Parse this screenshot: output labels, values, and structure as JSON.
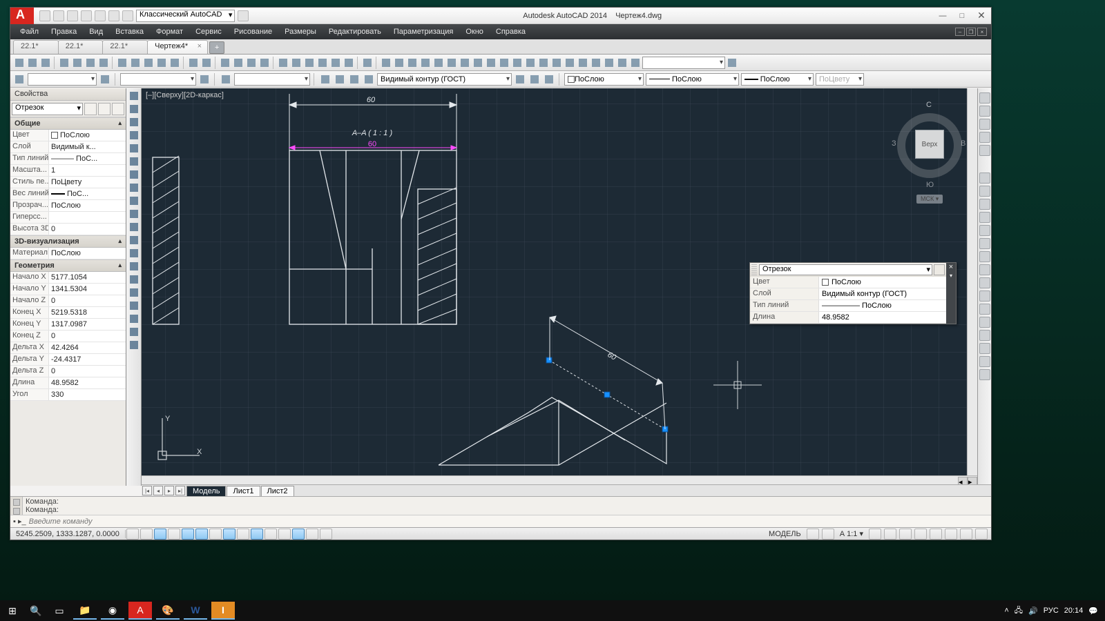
{
  "app": {
    "title_product": "Autodesk AutoCAD 2014",
    "title_file": "Чертеж4.dwg",
    "workspace": "Классический AutoCAD"
  },
  "menu": [
    "Файл",
    "Правка",
    "Вид",
    "Вставка",
    "Формат",
    "Сервис",
    "Рисование",
    "Размеры",
    "Редактировать",
    "Параметризация",
    "Окно",
    "Справка"
  ],
  "tabs": {
    "items": [
      "22.1*",
      "22.1*",
      "22.1*",
      "Чертеж4*"
    ],
    "active_index": 3
  },
  "layers_row": {
    "layer_combo": "Видимый контур (ГОСТ)",
    "color_combo": "ПоСлою",
    "linetype_combo": "ПоСлою",
    "lineweight_combo": "ПоСлою",
    "plotstyle_combo": "ПоЦвету"
  },
  "properties": {
    "title": "Свойства",
    "object_type": "Отрезок",
    "sections": {
      "general": {
        "label": "Общие",
        "rows": [
          {
            "k": "Цвет",
            "v": "ПоСлою",
            "swatch": true
          },
          {
            "k": "Слой",
            "v": "Видимый к..."
          },
          {
            "k": "Тип линий",
            "v": "——— ПоС..."
          },
          {
            "k": "Масшта...",
            "v": "1"
          },
          {
            "k": "Стиль пе...",
            "v": "ПоЦвету"
          },
          {
            "k": "Вес линий",
            "v": "ПоС...",
            "lw": true
          },
          {
            "k": "Прозрач...",
            "v": "ПоСлою"
          },
          {
            "k": "Гиперсс...",
            "v": ""
          },
          {
            "k": "Высота 3D",
            "v": "0"
          }
        ]
      },
      "viz3d": {
        "label": "3D-визуализация",
        "rows": [
          {
            "k": "Материал",
            "v": "ПоСлою"
          }
        ]
      },
      "geometry": {
        "label": "Геометрия",
        "rows": [
          {
            "k": "Начало X",
            "v": "5177.1054"
          },
          {
            "k": "Начало Y",
            "v": "1341.5304"
          },
          {
            "k": "Начало Z",
            "v": "0"
          },
          {
            "k": "Конец X",
            "v": "5219.5318"
          },
          {
            "k": "Конец Y",
            "v": "1317.0987"
          },
          {
            "k": "Конец Z",
            "v": "0"
          },
          {
            "k": "Дельта X",
            "v": "42.4264"
          },
          {
            "k": "Дельта Y",
            "v": "-24.4317"
          },
          {
            "k": "Дельта Z",
            "v": "0"
          },
          {
            "k": "Длина",
            "v": "48.9582"
          },
          {
            "k": "Угол",
            "v": "330"
          }
        ]
      }
    }
  },
  "viewport_label": "[–][Сверху][2D-каркас]",
  "section": {
    "dimension": "60",
    "title": "A–A ( 1 : 1 )",
    "aux_dim": "60",
    "floating_dim": "60"
  },
  "quickprops": {
    "type": "Отрезок",
    "rows": [
      {
        "k": "Цвет",
        "v": "ПоСлою",
        "swatch": true
      },
      {
        "k": "Слой",
        "v": "Видимый контур (ГОСТ)"
      },
      {
        "k": "Тип линий",
        "v": "————— ПоСлою"
      },
      {
        "k": "Длина",
        "v": "48.9582"
      }
    ]
  },
  "viewcube": {
    "face": "Верх",
    "n": "С",
    "s": "Ю",
    "w": "З",
    "e": "В",
    "cs": "МСК ▾"
  },
  "layout_tabs": {
    "model": "Модель",
    "sheets": [
      "Лист1",
      "Лист2"
    ]
  },
  "command": {
    "history": [
      "Команда:",
      "Команда:"
    ],
    "placeholder": "Введите команду"
  },
  "status": {
    "coords": "5245.2509, 1333.1287, 0.0000",
    "model_btn": "МОДЕЛЬ",
    "anno": "А 1:1 ▾"
  },
  "taskbar": {
    "lang": "РУС",
    "time": "20:14"
  },
  "chart_data": {
    "type": "table",
    "title": "Selected line (Отрезок) geometry",
    "rows": [
      {
        "prop": "Начало X",
        "value": 5177.1054
      },
      {
        "prop": "Начало Y",
        "value": 1341.5304
      },
      {
        "prop": "Начало Z",
        "value": 0
      },
      {
        "prop": "Конец X",
        "value": 5219.5318
      },
      {
        "prop": "Конец Y",
        "value": 1317.0987
      },
      {
        "prop": "Конец Z",
        "value": 0
      },
      {
        "prop": "Дельта X",
        "value": 42.4264
      },
      {
        "prop": "Дельта Y",
        "value": -24.4317
      },
      {
        "prop": "Дельта Z",
        "value": 0
      },
      {
        "prop": "Длина",
        "value": 48.9582
      },
      {
        "prop": "Угол",
        "value": 330
      }
    ],
    "dimension_shown": 60,
    "section_label": "A–A (1:1)"
  }
}
